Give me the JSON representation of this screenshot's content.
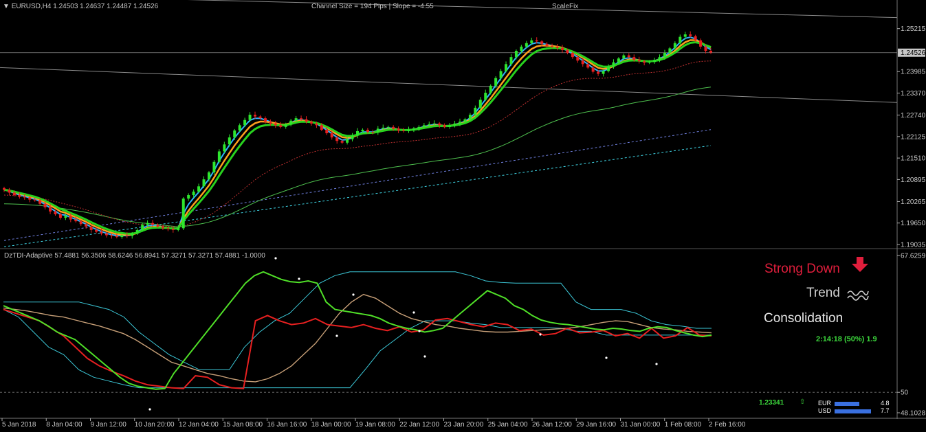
{
  "header": {
    "symbol_info": "EURUSD,H4  1.24503 1.24637 1.24487 1.24526",
    "channel_info": "Channel Size = 194 Pips  |  Slope = -4.55",
    "scale_label": "ScaleFix"
  },
  "indicator": {
    "title": "DzTDI-Adaptive 57.4881 56.3506 58.6246 56.8941 57.3271 57.3271 57.4881 -1.0000"
  },
  "signals": {
    "strong": "Strong Down",
    "trend": "Trend",
    "consolidation": "Consolidation",
    "timer": "2:14:18 (50%) 1.9",
    "level": "1.23341",
    "arrow_color": "#e01e3c",
    "strong_color": "#e01e3c",
    "timer_color": "#3cd83c"
  },
  "currency_strength": [
    {
      "name": "EUR",
      "value": "4.8"
    },
    {
      "name": "USD",
      "value": "7.7"
    }
  ],
  "chart_data": [
    {
      "type": "candlestick",
      "ylim": [
        1.19035,
        1.2572
      ],
      "y_ticks": [
        "1.25215",
        "1.24526",
        "1.23985",
        "1.23370",
        "1.22740",
        "1.22125",
        "1.21510",
        "1.20895",
        "1.20265",
        "1.19650",
        "1.19035"
      ],
      "current_price": "1.24526",
      "x_ticks": [
        "5 Jan 2018",
        "8 Jan 04:00",
        "9 Jan 12:00",
        "10 Jan 20:00",
        "12 Jan 04:00",
        "15 Jan 08:00",
        "16 Jan 16:00",
        "18 Jan 00:00",
        "19 Jan 08:00",
        "22 Jan 12:00",
        "23 Jan 20:00",
        "25 Jan 04:00",
        "26 Jan 12:00",
        "29 Jan 16:00",
        "31 Jan 00:00",
        "1 Feb 08:00",
        "2 Feb 16:00"
      ],
      "close": [
        1.206,
        1.2052,
        1.2045,
        1.204,
        1.2038,
        1.2032,
        1.203,
        1.202,
        1.201,
        1.1998,
        1.199,
        1.198,
        1.1985,
        1.1975,
        1.197,
        1.1962,
        1.1955,
        1.1945,
        1.194,
        1.1935,
        1.193,
        1.1928,
        1.1925,
        1.193,
        1.1928,
        1.1935,
        1.1945,
        1.196,
        1.1965,
        1.196,
        1.1955,
        1.195,
        1.1948,
        1.1945,
        1.195,
        1.2035,
        1.2045,
        1.2055,
        1.207,
        1.209,
        1.211,
        1.214,
        1.217,
        1.219,
        1.221,
        1.223,
        1.2245,
        1.226,
        1.2275,
        1.227,
        1.2265,
        1.2255,
        1.225,
        1.2245,
        1.224,
        1.2248,
        1.2258,
        1.2265,
        1.2262,
        1.2255,
        1.225,
        1.2245,
        1.2232,
        1.2222,
        1.221,
        1.22,
        1.2195,
        1.2205,
        1.2215,
        1.2228,
        1.2232,
        1.2226,
        1.2225,
        1.2235,
        1.2238,
        1.224,
        1.2235,
        1.223,
        1.2228,
        1.2232,
        1.2236,
        1.224,
        1.2245,
        1.2248,
        1.225,
        1.2245,
        1.224,
        1.2245,
        1.225,
        1.2255,
        1.2262,
        1.2275,
        1.2295,
        1.2318,
        1.2338,
        1.2358,
        1.238,
        1.24,
        1.242,
        1.244,
        1.2458,
        1.247,
        1.248,
        1.2488,
        1.2485,
        1.2478,
        1.2472,
        1.247,
        1.2466,
        1.246,
        1.2452,
        1.244,
        1.243,
        1.242,
        1.241,
        1.2398,
        1.2392,
        1.24,
        1.2412,
        1.2425,
        1.2436,
        1.2445,
        1.244,
        1.2432,
        1.2428,
        1.2424,
        1.2426,
        1.2432,
        1.244,
        1.2452,
        1.2465,
        1.248,
        1.2498,
        1.2505,
        1.25,
        1.2488,
        1.247,
        1.2458,
        1.2453
      ],
      "series": [
        {
          "name": "",
          "color": "#2db4ff"
        },
        {
          "name": "",
          "color": "#28d21e"
        },
        {
          "name": "",
          "color": "#ffa01e"
        }
      ]
    },
    {
      "type": "line",
      "ylim": [
        48.1028,
        67.6259
      ],
      "y_ticks": [
        "67.6259",
        "50",
        "48.1028"
      ],
      "lines": {
        "green": [
          61.5,
          61.0,
          60.5,
          60.0,
          59.5,
          58.8,
          58.0,
          57.5,
          57.0,
          56.0,
          55.0,
          54.0,
          53.0,
          52.0,
          51.2,
          50.8,
          50.6,
          50.4,
          50.5,
          52.5,
          54.0,
          55.5,
          57.0,
          58.5,
          60.0,
          61.5,
          63.0,
          64.5,
          65.5,
          66.0,
          65.5,
          65.0,
          64.7,
          64.6,
          64.8,
          64.5,
          62.0,
          61.0,
          60.8,
          60.6,
          60.4,
          60.2,
          59.8,
          59.2,
          58.8,
          58.5,
          58.3,
          58.0,
          58.2,
          58.5,
          59.5,
          60.5,
          61.5,
          62.5,
          63.5,
          63.0,
          62.5,
          61.5,
          61.0,
          60.2,
          59.6,
          59.3,
          59.1,
          59.0,
          58.8,
          58.6,
          58.4,
          58.3,
          58.5,
          58.4,
          58.2,
          58.1,
          58.5,
          58.7,
          58.6,
          58.2,
          57.9,
          57.6,
          57.4,
          57.6
        ],
        "red": [
          61.0,
          60.5,
          60.0,
          59.5,
          58.5,
          57.5,
          56.0,
          54.5,
          53.5,
          52.8,
          52.2,
          51.5,
          51.0,
          50.8,
          50.6,
          50.5,
          52.2,
          52.0,
          51.0,
          50.6,
          50.5,
          59.5,
          60.2,
          59.5,
          59.0,
          59.2,
          59.8,
          59.0,
          58.8,
          58.6,
          59.0,
          58.5,
          58.2,
          58.7,
          58.0,
          58.3,
          59.6,
          59.8,
          59.4,
          59.0,
          58.7,
          59.2,
          59.0,
          58.2,
          58.4,
          57.6,
          57.8,
          58.5,
          57.9,
          58.0,
          58.2,
          57.5,
          57.8,
          57.2,
          58.5,
          57.2,
          57.5,
          58.6,
          57.6,
          57.5
        ],
        "tan": [
          61.2,
          61.0,
          60.8,
          60.5,
          60.2,
          60.0,
          59.6,
          59.2,
          58.8,
          58.3,
          57.8,
          57.0,
          56.0,
          55.0,
          54.0,
          53.5,
          53.0,
          52.5,
          52.2,
          51.8,
          51.5,
          51.4,
          51.8,
          52.5,
          53.5,
          55.0,
          56.5,
          58.5,
          60.5,
          62.0,
          63.0,
          62.5,
          61.5,
          60.5,
          59.8,
          59.4,
          59.0,
          58.8,
          58.5,
          58.3,
          58.1,
          58.0,
          58.0,
          58.1,
          58.2,
          58.3,
          58.4,
          58.5,
          58.7,
          59.0,
          59.3,
          59.5,
          59.4,
          59.0,
          58.6,
          58.4,
          58.3,
          58.1,
          58.0,
          57.9
        ]
      }
    }
  ]
}
